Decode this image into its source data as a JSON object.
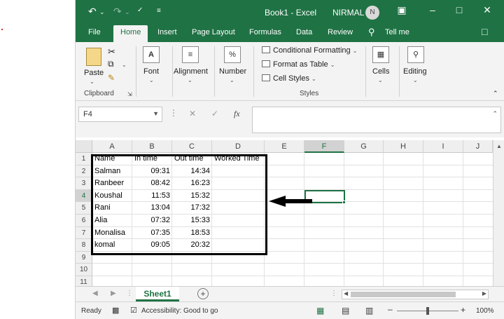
{
  "app": {
    "doc_title": "Book1  -  Excel",
    "user_name": "NIRMAL",
    "avatar_initial": "N"
  },
  "tabs": [
    "File",
    "Home",
    "Insert",
    "Page Layout",
    "Formulas",
    "Data",
    "Review"
  ],
  "tell_me": "Tell me",
  "ribbon": {
    "paste": "Paste",
    "clipboard": "Clipboard",
    "font": "Font",
    "alignment": "Alignment",
    "number": "Number",
    "conditional": "Conditional Formatting",
    "format_table": "Format as Table",
    "cell_styles": "Cell Styles",
    "styles": "Styles",
    "cells": "Cells",
    "editing": "Editing"
  },
  "formula_bar": {
    "name_box": "F4",
    "fx": "fx",
    "value": ""
  },
  "columns": [
    "A",
    "B",
    "C",
    "D",
    "E",
    "F",
    "G",
    "H",
    "I",
    "J"
  ],
  "rows": [
    "1",
    "2",
    "3",
    "4",
    "5",
    "6",
    "7",
    "8",
    "9",
    "10",
    "11"
  ],
  "sheet": {
    "headers": [
      "Name",
      "In time",
      "Out time",
      "Worked Time"
    ],
    "data": [
      [
        "Salman",
        "09:31",
        "14:34"
      ],
      [
        "Ranbeer",
        "08:42",
        "16:23"
      ],
      [
        "Koushal",
        "11:53",
        "15:32"
      ],
      [
        "Rani",
        "13:04",
        "17:32"
      ],
      [
        "Alia",
        "07:32",
        "15:33"
      ],
      [
        "Monalisa",
        "07:35",
        "18:53"
      ],
      [
        "komal",
        "09:05",
        "20:32"
      ]
    ]
  },
  "sheet_tab": "Sheet1",
  "status": {
    "ready": "Ready",
    "accessibility": "Accessibility: Good to go",
    "zoom": "100%"
  },
  "colors": {
    "excel_green": "#1f7244"
  }
}
